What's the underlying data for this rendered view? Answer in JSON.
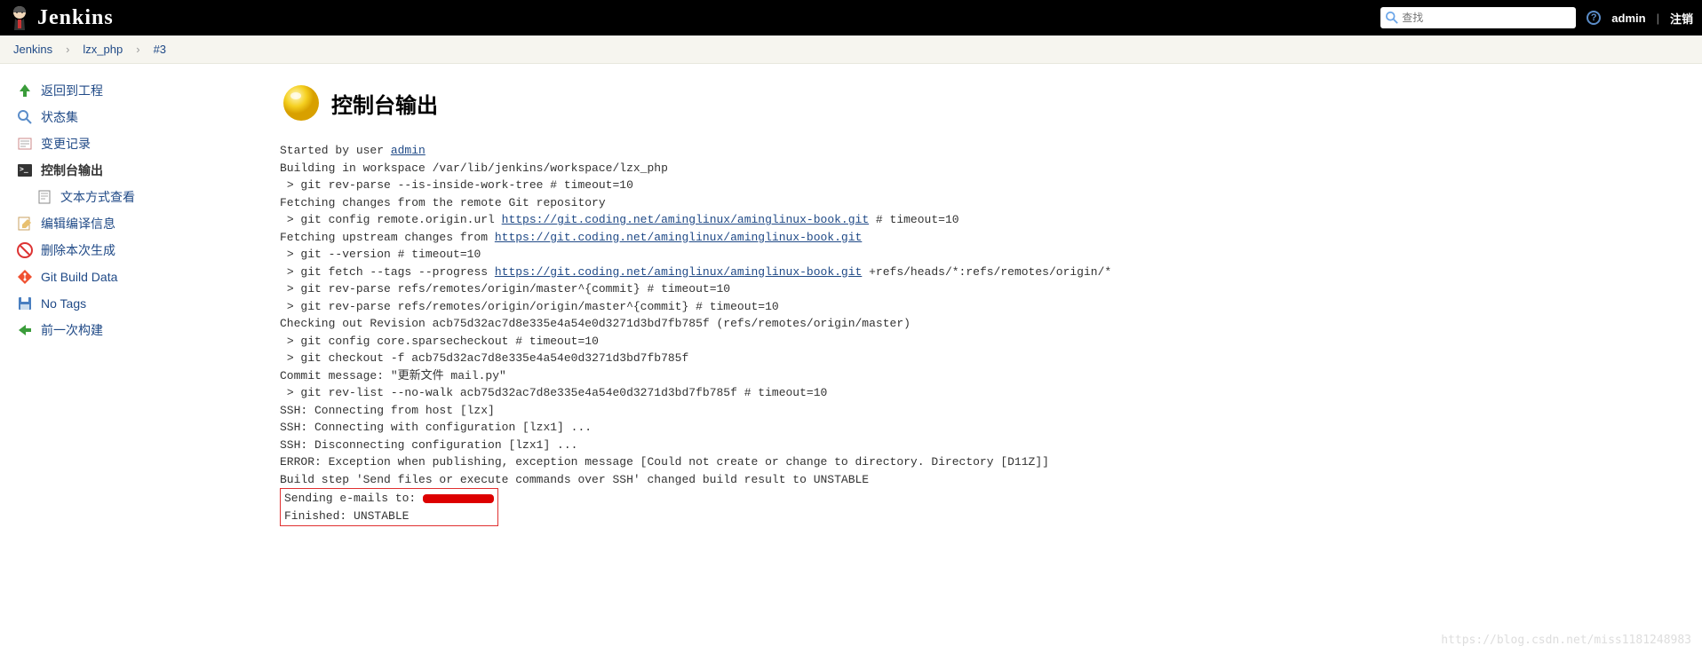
{
  "header": {
    "logo_text": "Jenkins",
    "search_placeholder": "查找",
    "user": "admin",
    "logout": "注销"
  },
  "breadcrumb": {
    "items": [
      "Jenkins",
      "lzx_php",
      "#3"
    ]
  },
  "sidebar": {
    "items": [
      {
        "label": "返回到工程"
      },
      {
        "label": "状态集"
      },
      {
        "label": "变更记录"
      },
      {
        "label": "控制台输出"
      },
      {
        "label": "文本方式查看"
      },
      {
        "label": "编辑编译信息"
      },
      {
        "label": "删除本次生成"
      },
      {
        "label": "Git Build Data"
      },
      {
        "label": "No Tags"
      },
      {
        "label": "前一次构建"
      }
    ]
  },
  "content": {
    "title": "控制台输出",
    "console": {
      "line1_pre": "Started by user ",
      "line1_link": "admin",
      "line2": "Building in workspace /var/lib/jenkins/workspace/lzx_php",
      "line3": " > git rev-parse --is-inside-work-tree # timeout=10",
      "line4": "Fetching changes from the remote Git repository",
      "line5_pre": " > git config remote.origin.url ",
      "line5_link": "https://git.coding.net/aminglinux/aminglinux-book.git",
      "line5_post": " # timeout=10",
      "line6_pre": "Fetching upstream changes from ",
      "line6_link": "https://git.coding.net/aminglinux/aminglinux-book.git",
      "line7": " > git --version # timeout=10",
      "line8_pre": " > git fetch --tags --progress ",
      "line8_link": "https://git.coding.net/aminglinux/aminglinux-book.git",
      "line8_post": " +refs/heads/*:refs/remotes/origin/*",
      "line9": " > git rev-parse refs/remotes/origin/master^{commit} # timeout=10",
      "line10": " > git rev-parse refs/remotes/origin/origin/master^{commit} # timeout=10",
      "line11": "Checking out Revision acb75d32ac7d8e335e4a54e0d3271d3bd7fb785f (refs/remotes/origin/master)",
      "line12": " > git config core.sparsecheckout # timeout=10",
      "line13": " > git checkout -f acb75d32ac7d8e335e4a54e0d3271d3bd7fb785f",
      "line14": "Commit message: \"更新文件 mail.py\"",
      "line15": " > git rev-list --no-walk acb75d32ac7d8e335e4a54e0d3271d3bd7fb785f # timeout=10",
      "line16": "SSH: Connecting from host [lzx]",
      "line17": "SSH: Connecting with configuration [lzx1] ...",
      "line18": "SSH: Disconnecting configuration [lzx1] ...",
      "line19": "ERROR: Exception when publishing, exception message [Could not create or change to directory. Directory [D11Z]]",
      "line20": "Build step 'Send files or execute commands over SSH' changed build result to UNSTABLE",
      "line21": "Sending e-mails to: ",
      "line22": "Finished: UNSTABLE"
    }
  },
  "watermark": "https://blog.csdn.net/miss1181248983"
}
